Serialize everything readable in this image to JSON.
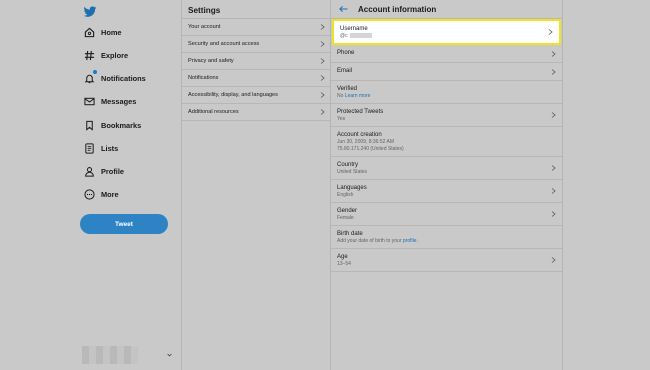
{
  "nav": {
    "items": [
      {
        "label": "Home",
        "icon": "home-icon"
      },
      {
        "label": "Explore",
        "icon": "hashtag-icon"
      },
      {
        "label": "Notifications",
        "icon": "bell-icon"
      },
      {
        "label": "Messages",
        "icon": "envelope-icon"
      },
      {
        "label": "Bookmarks",
        "icon": "bookmark-icon"
      },
      {
        "label": "Lists",
        "icon": "list-icon"
      },
      {
        "label": "Profile",
        "icon": "person-icon"
      },
      {
        "label": "More",
        "icon": "more-icon"
      }
    ],
    "tweet_label": "Tweet"
  },
  "settings": {
    "title": "Settings",
    "items": [
      "Your account",
      "Security and account access",
      "Privacy and safety",
      "Notifications",
      "Accessibility, display, and languages",
      "Additional resources"
    ]
  },
  "account_info": {
    "title": "Account information",
    "username": {
      "label": "Username",
      "value": "@c"
    },
    "phone": {
      "label": "Phone"
    },
    "email": {
      "label": "Email"
    },
    "verified": {
      "label": "Verified",
      "value": "No",
      "link": "Learn more"
    },
    "protected": {
      "label": "Protected Tweets",
      "value": "Yes"
    },
    "creation": {
      "label": "Account creation",
      "date": "Jun 30, 2009, 8:36:52 AM",
      "ip": "75.80.171.240 (United States)"
    },
    "country": {
      "label": "Country",
      "value": "United States"
    },
    "languages": {
      "label": "Languages",
      "value": "English"
    },
    "gender": {
      "label": "Gender",
      "value": "Female"
    },
    "birth": {
      "label": "Birth date",
      "value": "Add your date of birth to your",
      "link": "profile",
      "end": "."
    },
    "age": {
      "label": "Age",
      "value": "13–54"
    }
  },
  "colors": {
    "accent": "#2e83c5",
    "background": "#c9c9c9",
    "highlight_border": "#f3e21e"
  }
}
